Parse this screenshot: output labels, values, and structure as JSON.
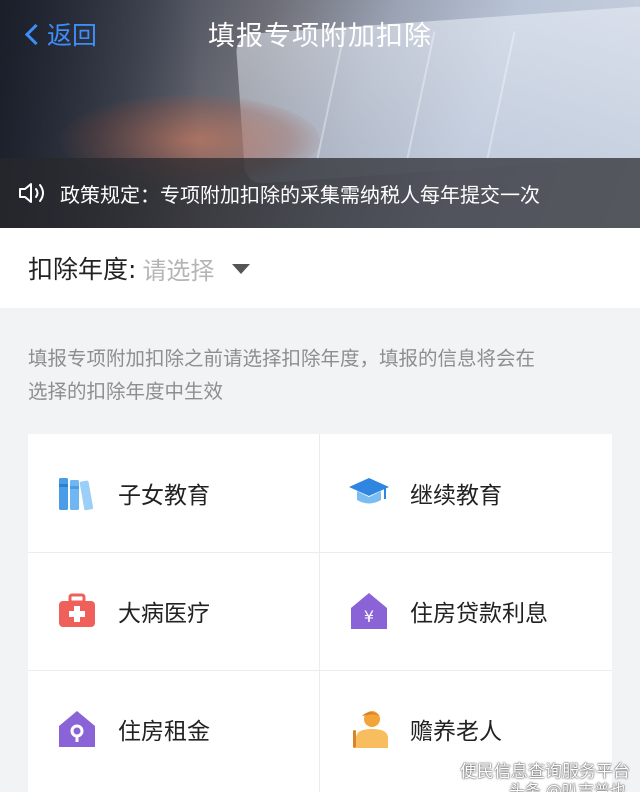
{
  "header": {
    "back_label": "返回",
    "title": "填报专项附加扣除"
  },
  "notice": {
    "icon": "speaker-icon",
    "text": "政策规定：专项附加扣除的采集需纳税人每年提交一次"
  },
  "year_selector": {
    "label": "扣除年度:",
    "placeholder": "请选择"
  },
  "description": {
    "line1": "填报专项附加扣除之前请选择扣除年度，填报的信息将会在",
    "line2": "选择的扣除年度中生效"
  },
  "categories": [
    {
      "label": "子女教育",
      "icon": "books-icon"
    },
    {
      "label": "继续教育",
      "icon": "graduation-cap-icon"
    },
    {
      "label": "大病医疗",
      "icon": "medical-kit-icon"
    },
    {
      "label": "住房贷款利息",
      "icon": "house-yuan-icon"
    },
    {
      "label": "住房租金",
      "icon": "house-key-icon"
    },
    {
      "label": "赡养老人",
      "icon": "elderly-person-icon"
    }
  ],
  "watermark": {
    "main": "便民信息查询服务平台",
    "sub": "头条 @叭吉普也"
  },
  "colors": {
    "accent": "#3d8ef7",
    "books": "#4a9be8",
    "cap": "#2f86e0",
    "medical": "#f0605a",
    "house": "#8a64d6",
    "elderly": "#f4a338"
  }
}
